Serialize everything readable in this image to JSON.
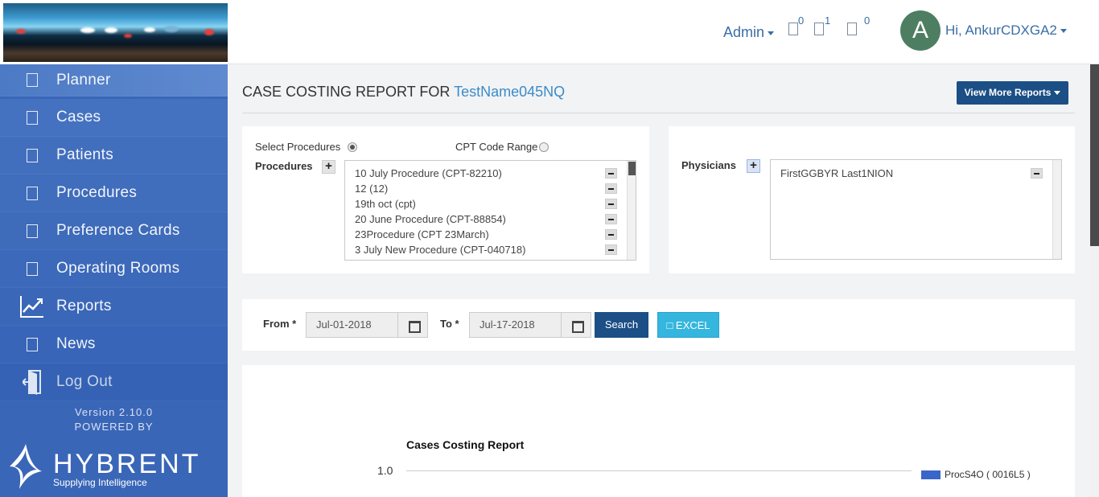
{
  "header": {
    "admin_label": "Admin",
    "counts": [
      "0",
      "1",
      "0"
    ],
    "avatar_letter": "A",
    "greeting": "Hi, AnkurCDXGA2"
  },
  "sidebar": {
    "items": [
      {
        "label": "Planner",
        "icon": "square-icon"
      },
      {
        "label": "Cases",
        "icon": "square-icon"
      },
      {
        "label": "Patients",
        "icon": "square-icon"
      },
      {
        "label": "Procedures",
        "icon": "square-icon"
      },
      {
        "label": "Preference Cards",
        "icon": "square-icon"
      },
      {
        "label": "Operating Rooms",
        "icon": "square-icon"
      },
      {
        "label": "Reports",
        "icon": "chart-line-icon"
      },
      {
        "label": "News",
        "icon": "square-icon"
      },
      {
        "label": "Log Out",
        "icon": "logout-icon"
      }
    ],
    "version": "Version 2.10.0",
    "powered_by": "POWERED BY",
    "brand": "HYBRENT",
    "tagline": "Supplying Intelligence"
  },
  "main": {
    "title_prefix": "CASE COSTING REPORT FOR",
    "title_name": "TestName045NQ",
    "view_more": "View More Reports"
  },
  "filters": {
    "select_procedures": "Select Procedures",
    "cpt_code_range": "CPT Code Range",
    "procedures_label": "Procedures",
    "procedures": [
      "10 July Procedure (CPT-82210)",
      "12 (12)",
      "19th oct (cpt)",
      "20 June Procedure (CPT-88854)",
      "23Procedure (CPT 23March)",
      "3 July New Procedure (CPT-040718)"
    ],
    "physicians_label": "Physicians",
    "physicians": [
      "FirstGGBYR Last1NION"
    ]
  },
  "dates": {
    "from_label": "From *",
    "from_value": "Jul-01-2018",
    "to_label": "To *",
    "to_value": "Jul-17-2018",
    "search": "Search",
    "excel": "□ EXCEL"
  },
  "chart_data": {
    "type": "bar",
    "title": "Cases Costing Report",
    "yticks": [
      "1.0"
    ],
    "series": [
      {
        "name": "ProcS4O ( 0016L5 )",
        "color": "#3a66c9"
      }
    ]
  }
}
